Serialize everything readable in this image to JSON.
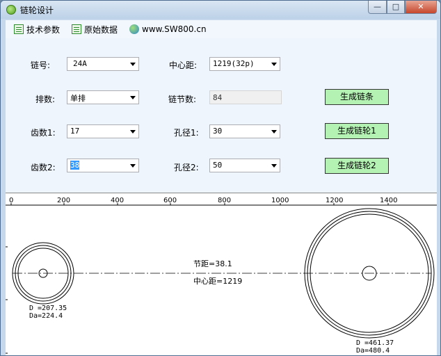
{
  "window": {
    "title": "链轮设计",
    "min_glyph": "—",
    "max_glyph": "□",
    "close_glyph": "✕"
  },
  "toolbar": {
    "tech_params": "技术参数",
    "raw_data": "原始数据",
    "website": "www.SW800.cn"
  },
  "form": {
    "chain_no_label": "链号:",
    "chain_no_value": "24A",
    "center_dist_label": "中心距:",
    "center_dist_value": "1219(32p)",
    "rows_label": "排数:",
    "rows_value": "单排",
    "links_label": "链节数:",
    "links_value": "84",
    "teeth1_label": "齿数1:",
    "teeth1_value": "17",
    "bore1_label": "孔径1:",
    "bore1_value": "30",
    "teeth2_label": "齿数2:",
    "teeth2_value": "38",
    "bore2_label": "孔径2:",
    "bore2_value": "50",
    "gen_chain": "生成链条",
    "gen_sprocket1": "生成链轮1",
    "gen_sprocket2": "生成链轮2"
  },
  "drawing": {
    "ruler_ticks": [
      "0",
      "200",
      "400",
      "600",
      "800",
      "1000",
      "1200",
      "1400"
    ],
    "pitch_text": "节距=38.1",
    "center_text": "中心距=1219",
    "sprocket1_D": "D =207.35",
    "sprocket1_Da": "Da=224.4",
    "sprocket2_D": "D =461.37",
    "sprocket2_Da": "Da=480.4"
  }
}
